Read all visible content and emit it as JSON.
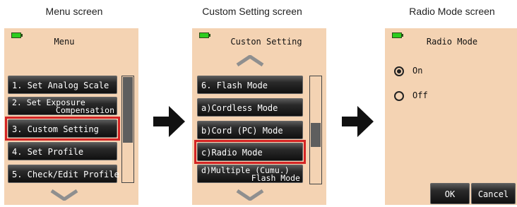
{
  "captions": {
    "menu": "Menu screen",
    "custom": "Custom Setting screen",
    "radio": "Radio Mode screen"
  },
  "menu_screen": {
    "title": "Menu",
    "items": [
      {
        "label": "1. Set Analog Scale"
      },
      {
        "label": "2. Set Exposure",
        "label2": "Compensation"
      },
      {
        "label": "3. Custom Setting",
        "highlighted": true
      },
      {
        "label": "4. Set Profile"
      },
      {
        "label": "5. Check/Edit Profile"
      }
    ]
  },
  "custom_screen": {
    "title": "Custon Setting",
    "items": [
      {
        "label": "6. Flash Mode"
      },
      {
        "label": "a)Cordless Mode"
      },
      {
        "label": "b)Cord (PC) Mode"
      },
      {
        "label": "c)Radio Mode",
        "highlighted": true
      },
      {
        "label": "d)Multiple (Cumu.)",
        "label2": "Flash Mode"
      }
    ]
  },
  "radio_screen": {
    "title": "Radio Mode",
    "options": [
      {
        "label": "On",
        "selected": true
      },
      {
        "label": "Off",
        "selected": false
      }
    ],
    "ok_label": "OK",
    "cancel_label": "Cancel"
  },
  "icons": {
    "battery": "battery-icon",
    "up": "up-chevron-icon",
    "down": "down-chevron-icon",
    "flow": "right-arrow-icon"
  },
  "colors": {
    "screen_bg": "#f4d3b3",
    "highlight": "#d32424",
    "battery": "#2ecc1f"
  }
}
